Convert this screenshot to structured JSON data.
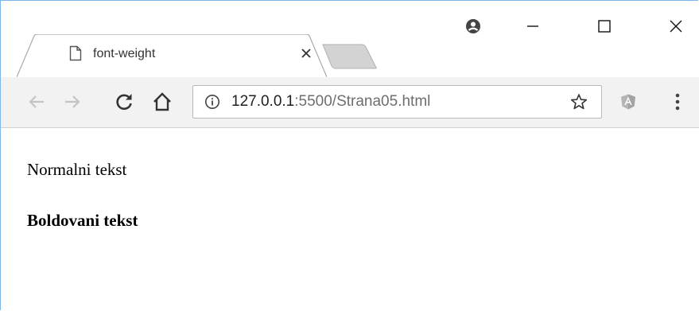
{
  "browser": {
    "tab": {
      "title": "font-weight",
      "favicon": "page-icon",
      "close_icon": "close-icon"
    },
    "new_tab_icon": "new-tab-icon",
    "profile_icon": "profile-icon",
    "window_controls": [
      "minimize-icon",
      "maximize-icon",
      "close-icon"
    ],
    "toolbar": {
      "icons": [
        "back-icon",
        "forward-icon",
        "reload-icon",
        "home-icon"
      ],
      "address": {
        "info_icon": "info-icon",
        "host": "127.0.0.1",
        "rest": ":5500/Strana05.html",
        "bookmark_icon": "star-icon"
      },
      "extension_icon": "angular-extension-icon",
      "menu_icon": "kebab-menu-icon"
    },
    "colors": {
      "window_border": "#7cb6ea",
      "toolbar_bg": "#f2f2f2",
      "text": "#000000"
    }
  },
  "page": {
    "paragraphs": [
      {
        "text": "Normalni tekst",
        "weight": "normal"
      },
      {
        "text": "Boldovani tekst",
        "weight": "bold"
      }
    ]
  }
}
